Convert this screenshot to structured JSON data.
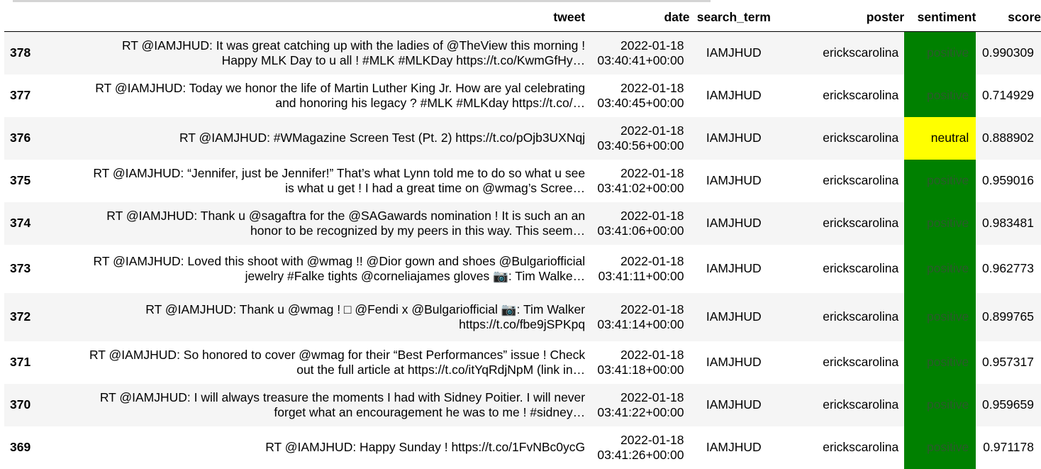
{
  "columns": {
    "index": "",
    "tweet": "tweet",
    "date": "date",
    "search_term": "search_term",
    "poster": "poster",
    "sentiment": "sentiment",
    "score": "score"
  },
  "colors": {
    "positive": "#008000",
    "neutral": "#ffff00",
    "row_alt": "#f5f5f5"
  },
  "rows": [
    {
      "index": "378",
      "tweet_line1": "RT @IAMJHUD: It was great catching up with the ladies of @TheView this morning !",
      "tweet_line2": "Happy MLK Day to u all ! #MLK #MLKDay https://t.co/KwmGfHy…",
      "date_line1": "2022-01-18",
      "date_line2": "03:40:41+00:00",
      "search_term": "IAMJHUD",
      "poster": "erickscarolina",
      "sentiment": "positive",
      "score": "0.990309"
    },
    {
      "index": "377",
      "tweet_line1": "RT @IAMJHUD: Today we honor the life of Martin Luther King Jr. How are yal celebrating",
      "tweet_line2": "and honoring his legacy ? #MLK #MLKday https://t.co/…",
      "date_line1": "2022-01-18",
      "date_line2": "03:40:45+00:00",
      "search_term": "IAMJHUD",
      "poster": "erickscarolina",
      "sentiment": "positive",
      "score": "0.714929"
    },
    {
      "index": "376",
      "tweet_line1": "RT @IAMJHUD: #WMagazine Screen Test (Pt. 2) https://t.co/pOjb3UXNqj",
      "tweet_line2": "",
      "date_line1": "2022-01-18",
      "date_line2": "03:40:56+00:00",
      "search_term": "IAMJHUD",
      "poster": "erickscarolina",
      "sentiment": "neutral",
      "score": "0.888902"
    },
    {
      "index": "375",
      "tweet_line1": "RT @IAMJHUD: “Jennifer, just be Jennifer!” That’s what Lynn told me to do so what u see",
      "tweet_line2": "is what u get ! I had a great time on @wmag’s Scree…",
      "date_line1": "2022-01-18",
      "date_line2": "03:41:02+00:00",
      "search_term": "IAMJHUD",
      "poster": "erickscarolina",
      "sentiment": "positive",
      "score": "0.959016"
    },
    {
      "index": "374",
      "tweet_line1": "RT @IAMJHUD: Thank u @sagaftra for the @SAGawards nomination ! It is such an an",
      "tweet_line2": "honor to be recognized by my peers in this way. This seem…",
      "date_line1": "2022-01-18",
      "date_line2": "03:41:06+00:00",
      "search_term": "IAMJHUD",
      "poster": "erickscarolina",
      "sentiment": "positive",
      "score": "0.983481"
    },
    {
      "index": "373",
      "tweet_line1": "RT @IAMJHUD: Loved this shoot with @wmag !! @Dior gown and shoes @Bulgariofficial",
      "tweet_line2": "jewelry #Falke tights @corneliajames gloves 📷: Tim Walke…",
      "date_line1": "2022-01-18",
      "date_line2": "03:41:11+00:00",
      "search_term": "IAMJHUD",
      "poster": "erickscarolina",
      "sentiment": "positive",
      "score": "0.962773"
    },
    {
      "index": "372",
      "tweet_line1": "RT @IAMJHUD: Thank u @wmag ! □ @Fendi x @Bulgariofficial 📷: Tim Walker",
      "tweet_line2": "https://t.co/fbe9jSPKpq",
      "date_line1": "2022-01-18",
      "date_line2": "03:41:14+00:00",
      "search_term": "IAMJHUD",
      "poster": "erickscarolina",
      "sentiment": "positive",
      "score": "0.899765"
    },
    {
      "index": "371",
      "tweet_line1": "RT @IAMJHUD: So honored to cover @wmag for their “Best Performances” issue ! Check",
      "tweet_line2": "out the full article at https://t.co/itYqRdjNpM (link in…",
      "date_line1": "2022-01-18",
      "date_line2": "03:41:18+00:00",
      "search_term": "IAMJHUD",
      "poster": "erickscarolina",
      "sentiment": "positive",
      "score": "0.957317"
    },
    {
      "index": "370",
      "tweet_line1": "RT @IAMJHUD: I will always treasure the moments I had with Sidney Poitier. I will never",
      "tweet_line2": "forget what an encouragement he was to me ! #sidney…",
      "date_line1": "2022-01-18",
      "date_line2": "03:41:22+00:00",
      "search_term": "IAMJHUD",
      "poster": "erickscarolina",
      "sentiment": "positive",
      "score": "0.959659"
    },
    {
      "index": "369",
      "tweet_line1": "RT @IAMJHUD: Happy Sunday ! https://t.co/1FvNBc0ycG",
      "tweet_line2": "",
      "date_line1": "2022-01-18",
      "date_line2": "03:41:26+00:00",
      "search_term": "IAMJHUD",
      "poster": "erickscarolina",
      "sentiment": "positive",
      "score": "0.971178"
    }
  ]
}
